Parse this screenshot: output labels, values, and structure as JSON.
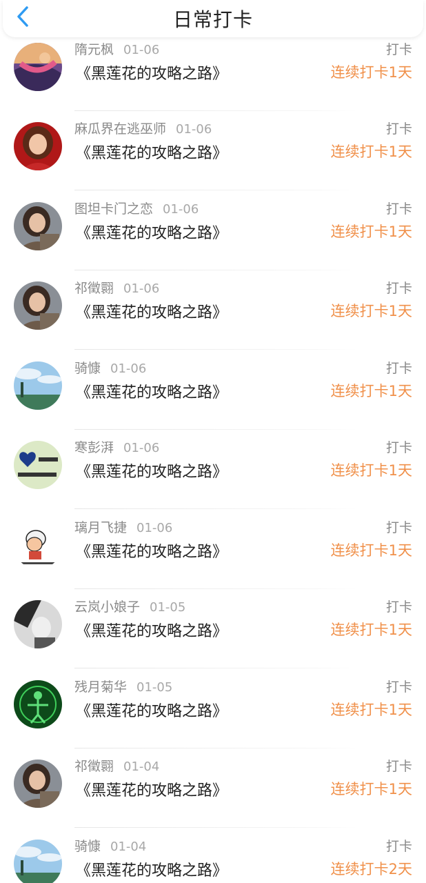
{
  "header": {
    "title": "日常打卡",
    "back_icon": "chevron-left-icon",
    "accent_color": "#2f9bf2"
  },
  "colors": {
    "streak": "#f0904a",
    "name": "#8a8a8a",
    "book": "#222222"
  },
  "checkins": [
    {
      "name": "隋元枫",
      "date": "01-06",
      "book": "《黑莲花的攻略之路》",
      "action": "打卡",
      "streak": "连续打卡1天",
      "avatar": "avatar-fantasy"
    },
    {
      "name": "麻瓜界在逃巫师",
      "date": "01-06",
      "book": "《黑莲花的攻略之路》",
      "action": "打卡",
      "streak": "连续打卡1天",
      "avatar": "avatar-girl-red"
    },
    {
      "name": "图坦卡门之恋",
      "date": "01-06",
      "book": "《黑莲花的攻略之路》",
      "action": "打卡",
      "streak": "连续打卡1天",
      "avatar": "avatar-woman"
    },
    {
      "name": "祁徵翾",
      "date": "01-06",
      "book": "《黑莲花的攻略之路》",
      "action": "打卡",
      "streak": "连续打卡1天",
      "avatar": "avatar-woman"
    },
    {
      "name": "骑慷",
      "date": "01-06",
      "book": "《黑莲花的攻略之路》",
      "action": "打卡",
      "streak": "连续打卡1天",
      "avatar": "avatar-sky"
    },
    {
      "name": "寒彭湃",
      "date": "01-06",
      "book": "《黑莲花的攻略之路》",
      "action": "打卡",
      "streak": "连续打卡1天",
      "avatar": "avatar-heart"
    },
    {
      "name": "璃月飞捷",
      "date": "01-06",
      "book": "《黑莲花的攻略之路》",
      "action": "打卡",
      "streak": "连续打卡1天",
      "avatar": "avatar-cartoon"
    },
    {
      "name": "云岚小娘子",
      "date": "01-05",
      "book": "《黑莲花的攻略之路》",
      "action": "打卡",
      "streak": "连续打卡1天",
      "avatar": "avatar-bw"
    },
    {
      "name": "残月菊华",
      "date": "01-05",
      "book": "《黑莲花的攻略之路》",
      "action": "打卡",
      "streak": "连续打卡1天",
      "avatar": "avatar-green"
    },
    {
      "name": "祁徵翾",
      "date": "01-04",
      "book": "《黑莲花的攻略之路》",
      "action": "打卡",
      "streak": "连续打卡1天",
      "avatar": "avatar-woman"
    },
    {
      "name": "骑慷",
      "date": "01-04",
      "book": "《黑莲花的攻略之路》",
      "action": "打卡",
      "streak": "连续打卡2天",
      "avatar": "avatar-sky"
    }
  ]
}
